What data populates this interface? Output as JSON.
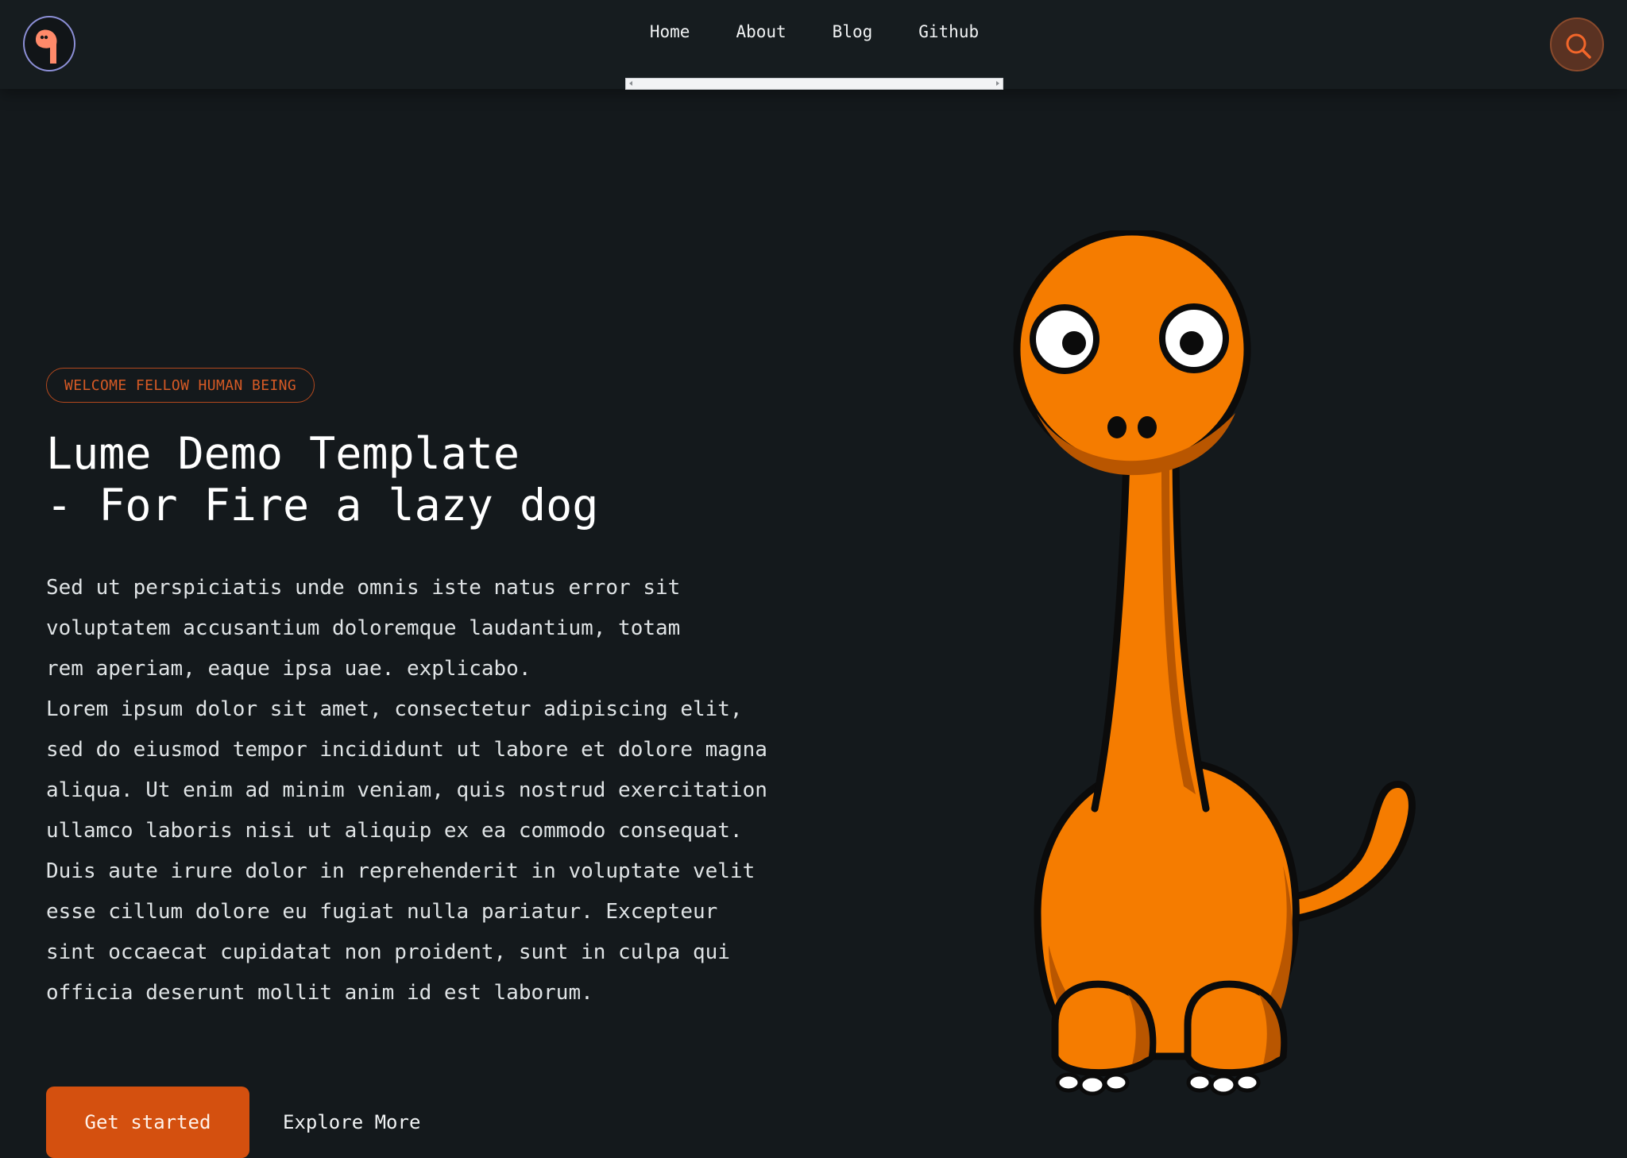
{
  "header": {
    "logo_icon": "dinosaur-logo-icon",
    "nav": [
      {
        "label": "Home"
      },
      {
        "label": "About"
      },
      {
        "label": "Blog"
      },
      {
        "label": "Github"
      }
    ],
    "search_icon": "search-icon"
  },
  "hero": {
    "badge": "WELCOME FELLOW HUMAN BEING",
    "title_line_1": "Lume Demo Template",
    "title_line_2": "- For Fire a lazy dog",
    "paragraph_1": "Sed ut perspiciatis unde omnis iste natus error sit voluptatem accusantium doloremque laudantium, totam rem aperiam, eaque ipsa uae. explicabo.",
    "paragraph_2": "Lorem ipsum dolor sit amet, consectetur adipiscing elit, sed do eiusmod tempor incididunt ut labore et dolore magna aliqua. Ut enim ad minim veniam, quis nostrud exercitation ullamco laboris nisi ut aliquip ex ea commodo consequat. Duis aute irure dolor in reprehenderit in voluptate velit esse cillum dolore eu fugiat nulla pariatur. Excepteur sint occaecat cupidatat non proident, sunt in culpa qui officia deserunt mollit anim id est laborum.",
    "primary_button": "Get started",
    "secondary_button": "Explore More",
    "illustration": "orange-dinosaur-illustration"
  },
  "colors": {
    "background": "#14191c",
    "header": "#161c1f",
    "accent": "#d4500f",
    "dino_orange": "#f57c00"
  }
}
